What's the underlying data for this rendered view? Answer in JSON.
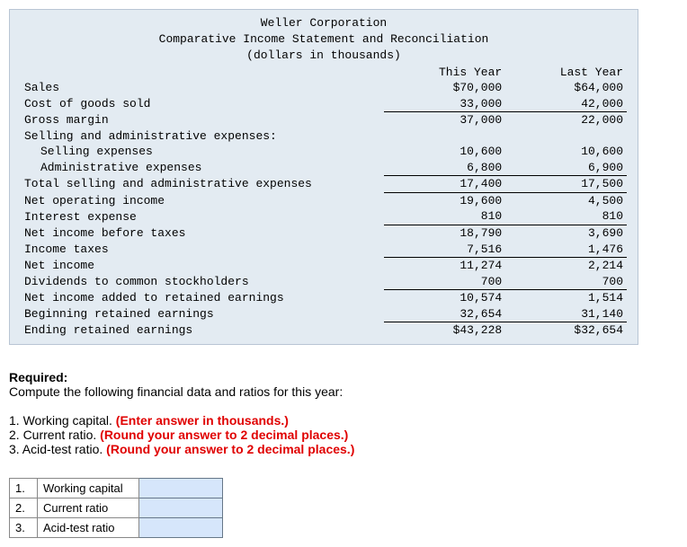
{
  "statement": {
    "company": "Weller Corporation",
    "title": "Comparative Income Statement and Reconciliation",
    "units": "(dollars in thousands)",
    "col_this": "This Year",
    "col_last": "Last Year",
    "rows": [
      {
        "label": "Sales",
        "this": "$70,000",
        "last": "$64,000",
        "indent": 0,
        "u": false
      },
      {
        "label": "Cost of goods sold",
        "this": "33,000",
        "last": "42,000",
        "indent": 0,
        "u": true
      },
      {
        "label": "Gross margin",
        "this": "37,000",
        "last": "22,000",
        "indent": 0,
        "u": false
      },
      {
        "label": "Selling and administrative expenses:",
        "this": "",
        "last": "",
        "indent": 0,
        "u": false
      },
      {
        "label": "Selling expenses",
        "this": "10,600",
        "last": "10,600",
        "indent": 1,
        "u": false
      },
      {
        "label": "Administrative expenses",
        "this": "6,800",
        "last": "6,900",
        "indent": 1,
        "u": true
      },
      {
        "label": "Total selling and administrative expenses",
        "this": "17,400",
        "last": "17,500",
        "indent": 0,
        "u": true
      },
      {
        "label": "Net operating income",
        "this": "19,600",
        "last": "4,500",
        "indent": 0,
        "u": false
      },
      {
        "label": "Interest expense",
        "this": "810",
        "last": "810",
        "indent": 0,
        "u": true
      },
      {
        "label": "Net income before taxes",
        "this": "18,790",
        "last": "3,690",
        "indent": 0,
        "u": false
      },
      {
        "label": "Income taxes",
        "this": "7,516",
        "last": "1,476",
        "indent": 0,
        "u": true
      },
      {
        "label": "Net income",
        "this": "11,274",
        "last": "2,214",
        "indent": 0,
        "u": false
      },
      {
        "label": "Dividends to common stockholders",
        "this": "700",
        "last": "700",
        "indent": 0,
        "u": true
      },
      {
        "label": "Net income added to retained earnings",
        "this": "10,574",
        "last": "1,514",
        "indent": 0,
        "u": false
      },
      {
        "label": "Beginning retained earnings",
        "this": "32,654",
        "last": "31,140",
        "indent": 0,
        "u": true
      },
      {
        "label": "Ending retained earnings",
        "this": "$43,228",
        "last": "$32,654",
        "indent": 0,
        "u": false
      }
    ]
  },
  "required": {
    "heading": "Required:",
    "prompt": "Compute the following financial data and ratios for this year:",
    "items": [
      {
        "text": "1. Working capital. ",
        "hint": "(Enter answer in thousands.)"
      },
      {
        "text": "2. Current ratio. ",
        "hint": "(Round your answer to 2 decimal places.)"
      },
      {
        "text": "3. Acid-test ratio. ",
        "hint": "(Round your answer to 2 decimal places.)"
      }
    ]
  },
  "answers": [
    {
      "num": "1.",
      "label": "Working capital"
    },
    {
      "num": "2.",
      "label": "Current ratio"
    },
    {
      "num": "3.",
      "label": "Acid-test ratio"
    }
  ]
}
